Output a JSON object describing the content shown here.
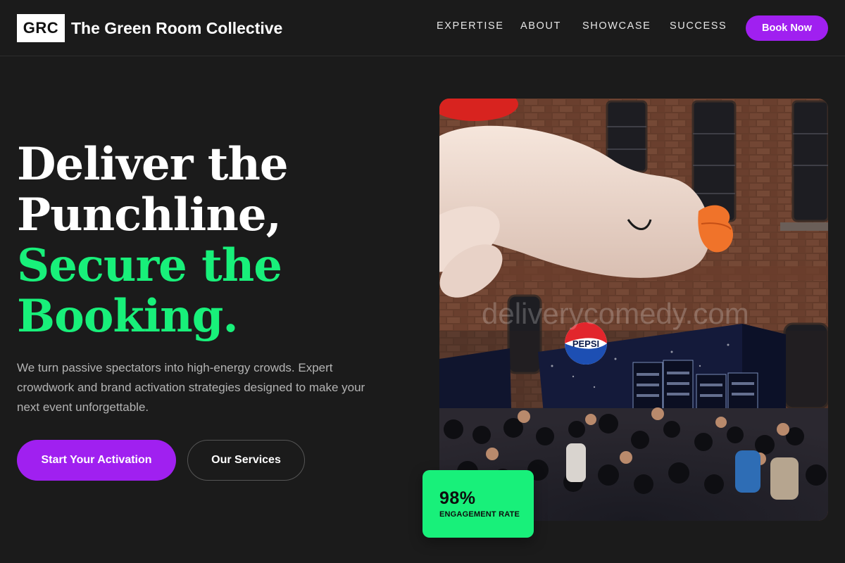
{
  "brand": {
    "badge": "GRC",
    "name": "The Green Room Collective"
  },
  "nav": {
    "links": [
      "EXPERTISE",
      "ABOUT",
      "SHOWCASE",
      "SUCCESS"
    ],
    "cta_label": "Book Now"
  },
  "hero": {
    "headline_line1": "Deliver the",
    "headline_line2": "Punchline,",
    "headline_line3": "Secure the",
    "headline_line4": "Booking.",
    "subcopy": "We turn passive spectators into high-energy crowds. Expert crowdwork and brand activation strategies designed to make your next event unforgettable.",
    "primary_button": "Start Your Activation",
    "secondary_button": "Our Services"
  },
  "image": {
    "watermark": "deliverycomedy.com",
    "booth_logo": "PEPSI"
  },
  "stat": {
    "value": "98%",
    "label": "ENGAGEMENT RATE"
  },
  "colors": {
    "background": "#1b1b1b",
    "accent_purple": "#a020f0",
    "accent_green": "#18f07a"
  }
}
